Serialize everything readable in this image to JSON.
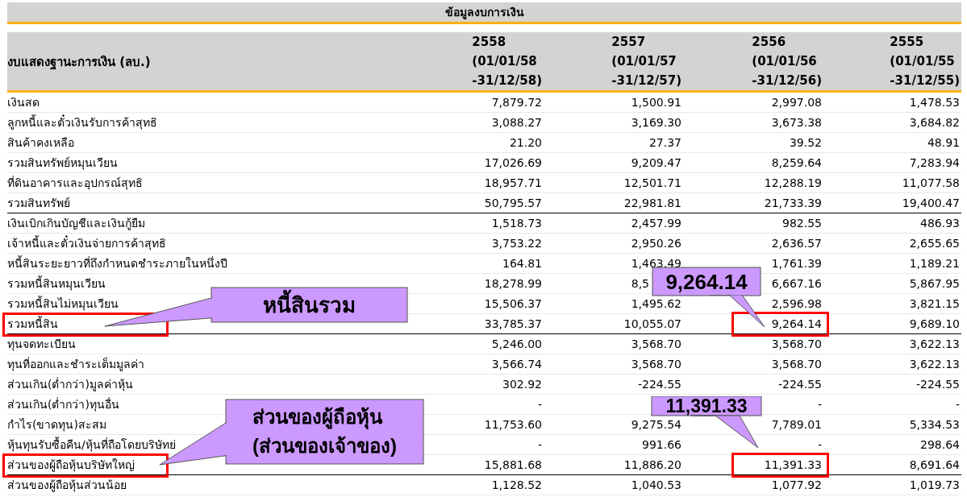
{
  "title": "ข้อมูลงบการเงิน",
  "table": {
    "columns": [
      {
        "label": "งบแสดงฐานะการเงิน (ลบ.)"
      },
      {
        "year": "2558",
        "from": "(01/01/58",
        "to": "-31/12/58)"
      },
      {
        "year": "2557",
        "from": "(01/01/57",
        "to": "-31/12/57)"
      },
      {
        "year": "2556",
        "from": "(01/01/56",
        "to": "-31/12/56)"
      },
      {
        "year": "2555",
        "from": "(01/01/55",
        "to": "-31/12/55)"
      }
    ],
    "rows": [
      {
        "label": "เงินสด",
        "values": [
          {
            "text": "7,879.72",
            "boxed": false
          },
          {
            "text": "1,500.91",
            "boxed": false
          },
          {
            "text": "2,997.08",
            "boxed": false
          },
          {
            "text": "1,478.53",
            "boxed": false
          }
        ],
        "rule_below": false,
        "label_boxed": false
      },
      {
        "label": "ลูกหนี้และตั๋วเงินรับการค้าสุทธิ",
        "values": [
          {
            "text": "3,088.27",
            "boxed": false
          },
          {
            "text": "3,169.30",
            "boxed": false
          },
          {
            "text": "3,673.38",
            "boxed": false
          },
          {
            "text": "3,684.82",
            "boxed": false
          }
        ],
        "rule_below": false,
        "label_boxed": false
      },
      {
        "label": "สินค้าคงเหลือ",
        "values": [
          {
            "text": "21.20",
            "boxed": false
          },
          {
            "text": "27.37",
            "boxed": false
          },
          {
            "text": "39.52",
            "boxed": false
          },
          {
            "text": "48.91",
            "boxed": false
          }
        ],
        "rule_below": false,
        "label_boxed": false
      },
      {
        "label": "รวมสินทรัพย์หมุนเวียน",
        "values": [
          {
            "text": "17,026.69",
            "boxed": false
          },
          {
            "text": "9,209.47",
            "boxed": false
          },
          {
            "text": "8,259.64",
            "boxed": false
          },
          {
            "text": "7,283.94",
            "boxed": false
          }
        ],
        "rule_below": false,
        "label_boxed": false
      },
      {
        "label": "ที่ดินอาคารและอุปกรณ์สุทธิ",
        "values": [
          {
            "text": "18,957.71",
            "boxed": false
          },
          {
            "text": "12,501.71",
            "boxed": false
          },
          {
            "text": "12,288.19",
            "boxed": false
          },
          {
            "text": "11,077.58",
            "boxed": false
          }
        ],
        "rule_below": false,
        "label_boxed": false
      },
      {
        "label": "รวมสินทรัพย์",
        "values": [
          {
            "text": "50,795.57",
            "boxed": false
          },
          {
            "text": "22,981.81",
            "boxed": false
          },
          {
            "text": "21,733.39",
            "boxed": false
          },
          {
            "text": "19,400.47",
            "boxed": false
          }
        ],
        "rule_below": true,
        "label_boxed": false
      },
      {
        "label": "เงินเบิกเกินบัญชีและเงินกู้ยืม",
        "values": [
          {
            "text": "1,518.73",
            "boxed": false
          },
          {
            "text": "2,457.99",
            "boxed": false
          },
          {
            "text": "982.55",
            "boxed": false
          },
          {
            "text": "486.93",
            "boxed": false
          }
        ],
        "rule_below": false,
        "label_boxed": false
      },
      {
        "label": "เจ้าหนี้และตั๋วเงินจ่ายการค้าสุทธิ",
        "values": [
          {
            "text": "3,753.22",
            "boxed": false
          },
          {
            "text": "2,950.26",
            "boxed": false
          },
          {
            "text": "2,636.57",
            "boxed": false
          },
          {
            "text": "2,655.65",
            "boxed": false
          }
        ],
        "rule_below": false,
        "label_boxed": false
      },
      {
        "label": "หนี้สินระยะยาวที่ถึงกำหนดชำระภายในหนึ่งปี",
        "values": [
          {
            "text": "164.81",
            "boxed": false
          },
          {
            "text": "1,463.49",
            "boxed": false
          },
          {
            "text": "1,761.39",
            "boxed": false
          },
          {
            "text": "1,189.21",
            "boxed": false
          }
        ],
        "rule_below": false,
        "label_boxed": false
      },
      {
        "label": "รวมหนี้สินหมุนเวียน",
        "values": [
          {
            "text": "18,278.99",
            "boxed": false
          },
          {
            "text": "8,5",
            "boxed": false
          },
          {
            "text": "6,667.16",
            "boxed": false
          },
          {
            "text": "5,867.95",
            "boxed": false
          }
        ],
        "rule_below": false,
        "label_boxed": false
      },
      {
        "label": "รวมหนี้สินไม่หมุนเวียน",
        "values": [
          {
            "text": "15,506.37",
            "boxed": false
          },
          {
            "text": "1,495.62",
            "boxed": false
          },
          {
            "text": "2,596.98",
            "boxed": false
          },
          {
            "text": "3,821.15",
            "boxed": false
          }
        ],
        "rule_below": false,
        "label_boxed": false
      },
      {
        "label": "รวมหนี้สิน",
        "values": [
          {
            "text": "33,785.37",
            "boxed": false
          },
          {
            "text": "10,055.07",
            "boxed": false
          },
          {
            "text": "9,264.14",
            "boxed": true
          },
          {
            "text": "9,689.10",
            "boxed": false
          }
        ],
        "rule_below": true,
        "label_boxed": true
      },
      {
        "label": "ทุนจดทะเบียน",
        "values": [
          {
            "text": "5,246.00",
            "boxed": false
          },
          {
            "text": "3,568.70",
            "boxed": false
          },
          {
            "text": "3,568.70",
            "boxed": false
          },
          {
            "text": "3,622.13",
            "boxed": false
          }
        ],
        "rule_below": false,
        "label_boxed": false
      },
      {
        "label": "ทุนที่ออกและชำระเต็มมูลค่า",
        "values": [
          {
            "text": "3,566.74",
            "boxed": false
          },
          {
            "text": "3,568.70",
            "boxed": false
          },
          {
            "text": "3,568.70",
            "boxed": false
          },
          {
            "text": "3,622.13",
            "boxed": false
          }
        ],
        "rule_below": false,
        "label_boxed": false
      },
      {
        "label": "ส่วนเกิน(ต่ำกว่า)มูลค่าหุ้น",
        "values": [
          {
            "text": "302.92",
            "boxed": false
          },
          {
            "text": "-224.55",
            "boxed": false
          },
          {
            "text": "-224.55",
            "boxed": false
          },
          {
            "text": "-224.55",
            "boxed": false
          }
        ],
        "rule_below": false,
        "label_boxed": false
      },
      {
        "label": "ส่วนเกิน(ต่ำกว่า)ทุนอื่น",
        "values": [
          {
            "text": "-",
            "boxed": false
          },
          {
            "boxed": false
          },
          {
            "text": "-",
            "boxed": false
          },
          {
            "text": "-",
            "boxed": false
          }
        ],
        "rule_below": false,
        "label_boxed": false
      },
      {
        "label": "กำไร(ขาดทุน)สะสม",
        "values": [
          {
            "text": "11,753.60",
            "boxed": false
          },
          {
            "text": "9,275.54",
            "boxed": false
          },
          {
            "text": "7,789.01",
            "boxed": false
          },
          {
            "text": "5,334.53",
            "boxed": false
          }
        ],
        "rule_below": false,
        "label_boxed": false
      },
      {
        "label": "หุ้นทุนรับซื้อคืน/หุ้นที่ถือโดยบริษัทย่",
        "values": [
          {
            "text": "-",
            "boxed": false
          },
          {
            "text": "991.66",
            "boxed": false
          },
          {
            "text": "-",
            "boxed": false
          },
          {
            "text": "298.64",
            "boxed": false
          }
        ],
        "rule_below": false,
        "label_boxed": false
      },
      {
        "label": "ส่วนของผู้ถือหุ้นบริษัทใหญ่",
        "values": [
          {
            "text": "15,881.68",
            "boxed": false
          },
          {
            "text": "11,886.20",
            "boxed": false
          },
          {
            "text": "11,391.33",
            "boxed": true
          },
          {
            "text": "8,691.64",
            "boxed": false
          }
        ],
        "rule_below": true,
        "label_boxed": true
      },
      {
        "label": "ส่วนของผู้ถือหุ้นส่วนน้อย",
        "values": [
          {
            "text": "1,128.52",
            "boxed": false
          },
          {
            "text": "1,040.53",
            "boxed": false
          },
          {
            "text": "1,077.92",
            "boxed": false
          },
          {
            "text": "1,019.73",
            "boxed": false
          }
        ],
        "rule_below": false,
        "label_boxed": false
      }
    ]
  },
  "callouts": [
    {
      "lines": [
        "9,264.14"
      ]
    },
    {
      "lines": [
        "หนี้สินรวม"
      ]
    },
    {
      "lines": [
        "ส่วนของผู้ถือหุ้น",
        "(ส่วนของเจ้าของ)"
      ]
    },
    {
      "lines": [
        "11,391.33"
      ]
    }
  ]
}
